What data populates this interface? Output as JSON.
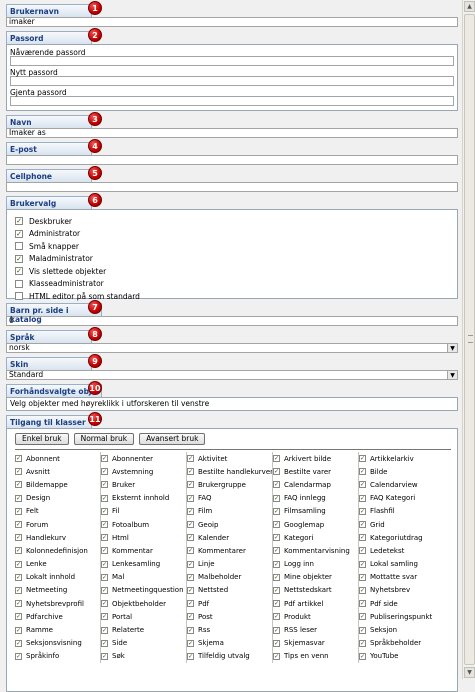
{
  "markers": [
    "1",
    "2",
    "3",
    "4",
    "5",
    "6",
    "7",
    "8",
    "9",
    "10",
    "11"
  ],
  "username": {
    "label": "Brukernavn",
    "value": "imaker"
  },
  "password": {
    "label": "Passord",
    "current": "Nåværende passord",
    "new": "Nytt passord",
    "repeat": "Gjenta passord"
  },
  "name": {
    "label": "Navn",
    "value": "Imaker as"
  },
  "email": {
    "label": "E-post",
    "value": ""
  },
  "cellphone": {
    "label": "Cellphone",
    "value": ""
  },
  "user_options": {
    "label": "Brukervalg",
    "items": [
      {
        "label": "Deskbruker",
        "checked": true
      },
      {
        "label": "Administrator",
        "checked": true
      },
      {
        "label": "Små knapper",
        "checked": false
      },
      {
        "label": "Maladministrator",
        "checked": true
      },
      {
        "label": "Vis slettede objekter",
        "checked": true
      },
      {
        "label": "Klasseadministrator",
        "checked": false
      },
      {
        "label": "HTML editor på som standard",
        "checked": false
      }
    ]
  },
  "children_per_page": {
    "label": "Barn pr. side i katalog",
    "value": "0"
  },
  "language": {
    "label": "Språk",
    "value": "norsk"
  },
  "skin": {
    "label": "Skin",
    "value": "Standard"
  },
  "preselected": {
    "label": "Forhåndsvalgte obj.",
    "text": "Velg objekter med høyreklikk i utforskeren til venstre"
  },
  "class_access": {
    "label": "Tilgang til klasser",
    "buttons": {
      "simple": "Enkel bruk",
      "normal": "Normal bruk",
      "advanced": "Avansert bruk"
    },
    "columns": [
      [
        "Abonnent",
        "Avsnitt",
        "Bildemappe",
        "Design",
        "Felt",
        "Forum",
        "Handlekurv",
        "Kolonnedefinisjon",
        "Lenke",
        "Lokalt innhold",
        "Netmeeting",
        "Nyhetsbrevprofil",
        "Pdfarchive",
        "Ramme",
        "Seksjonsvisning",
        "Språkinfo"
      ],
      [
        "Abonnenter",
        "Avstemning",
        "Bruker",
        "Eksternt innhold",
        "Fil",
        "Fotoalbum",
        "Html",
        "Kommentar",
        "Lenkesamling",
        "Mal",
        "Netmeetingquestion",
        "Objektbeholder",
        "Portal",
        "Relaterte",
        "Side",
        "Søk"
      ],
      [
        "Aktivitet",
        "Bestilte handlekurver",
        "Brukergruppe",
        "FAQ",
        "Film",
        "Geoip",
        "Kalender",
        "Kommentarer",
        "Linje",
        "Malbeholder",
        "Nettsted",
        "Pdf",
        "Post",
        "Rss",
        "Skjema",
        "Tilfeldig utvalg"
      ],
      [
        "Arkivert bilde",
        "Bestilte varer",
        "Calendarmap",
        "FAQ innlegg",
        "Filmsamling",
        "Googlemap",
        "Kategori",
        "Kommentarvisning",
        "Logg inn",
        "Mine objekter",
        "Nettstedskart",
        "Pdf artikkel",
        "Produkt",
        "RSS leser",
        "Skjemasvar",
        "Tips en venn"
      ],
      [
        "Artikkelarkiv",
        "Bilde",
        "Calendarview",
        "FAQ Kategori",
        "Flashfil",
        "Grid",
        "Kategoriutdrag",
        "Ledetekst",
        "Lokal samling",
        "Mottatte svar",
        "Nyhetsbrev",
        "Pdf side",
        "Publiseringspunkt",
        "Seksjon",
        "Språkbeholder",
        "YouTube"
      ]
    ]
  },
  "colors": {
    "badge": "#c40000",
    "header_text": "#1b3f82",
    "check": "#2a5c00"
  },
  "icons": {
    "check": "checkmark-icon",
    "dropdown": "dropdown-arrow-icon"
  }
}
